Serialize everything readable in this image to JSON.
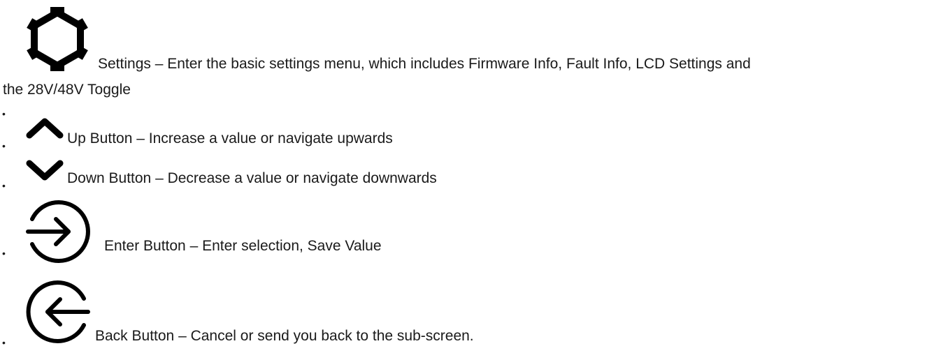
{
  "items": [
    {
      "icon": "gear-icon",
      "text": "Settings – Enter the basic settings menu, which includes Firmware Info, Fault Info, LCD Settings and",
      "text_cont": "the 28V/48V Toggle"
    },
    {
      "icon": "chevron-up-icon",
      "text": "Up Button – Increase a value or navigate upwards"
    },
    {
      "icon": "chevron-down-icon",
      "text": "Down Button – Decrease a value or navigate downwards"
    },
    {
      "icon": "enter-arrow-icon",
      "text": "Enter Button – Enter selection, Save Value"
    },
    {
      "icon": "back-arrow-icon",
      "text": "Back Button – Cancel or send you back to the sub-screen."
    }
  ],
  "bullet_char": "•"
}
